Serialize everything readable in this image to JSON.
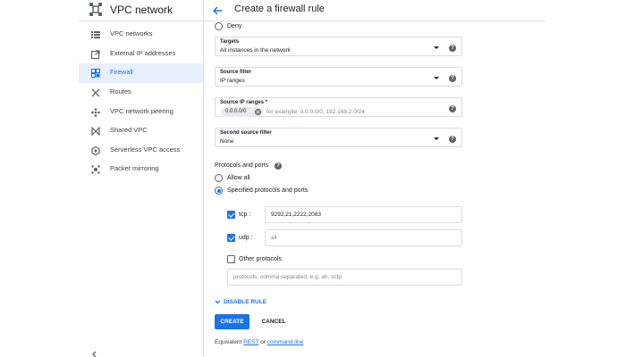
{
  "sidebar": {
    "title": "VPC network",
    "items": [
      {
        "label": "VPC networks",
        "icon": "vpc-networks-icon"
      },
      {
        "label": "External IP addresses",
        "icon": "external-ip-icon"
      },
      {
        "label": "Firewall",
        "icon": "firewall-icon",
        "active": true
      },
      {
        "label": "Routes",
        "icon": "routes-icon"
      },
      {
        "label": "VPC network peering",
        "icon": "peering-icon"
      },
      {
        "label": "Shared VPC",
        "icon": "shared-vpc-icon"
      },
      {
        "label": "Serverless VPC access",
        "icon": "serverless-icon"
      },
      {
        "label": "Packet mirroring",
        "icon": "packet-mirroring-icon"
      }
    ]
  },
  "header": {
    "title": "Create a firewall rule"
  },
  "action": {
    "deny_label": "Deny"
  },
  "targets": {
    "label": "Targets",
    "value": "All instances in the network"
  },
  "source_filter": {
    "label": "Source filter",
    "value": "IP ranges"
  },
  "source_ip_ranges": {
    "label": "Source IP ranges *",
    "chip": "0.0.0.0/0",
    "placeholder": "for example, 0.0.0.0/0, 192.168.2.0/24"
  },
  "second_source_filter": {
    "label": "Second source filter",
    "value": "None"
  },
  "protocols": {
    "title": "Protocols and ports",
    "allow_all_label": "Allow all",
    "specified_label": "Specified protocols and ports",
    "tcp": {
      "label": "tcp :",
      "value": "9292,21,2222,2083",
      "checked": true
    },
    "udp": {
      "label": "udp :",
      "placeholder": "all",
      "checked": true
    },
    "other": {
      "label": "Other protocols",
      "placeholder": "protocols, comma separated, e.g. ah, sctp",
      "checked": false
    }
  },
  "disable_rule_label": "DISABLE RULE",
  "buttons": {
    "create": "CREATE",
    "cancel": "CANCEL"
  },
  "equivalent": {
    "prefix": "Equivalent",
    "rest": "REST",
    "or": "or",
    "command_line": "command line"
  },
  "colors": {
    "accent": "#1a73e8",
    "active_bg": "#e8f0fe",
    "text": "#202124",
    "border": "#dadce0"
  }
}
